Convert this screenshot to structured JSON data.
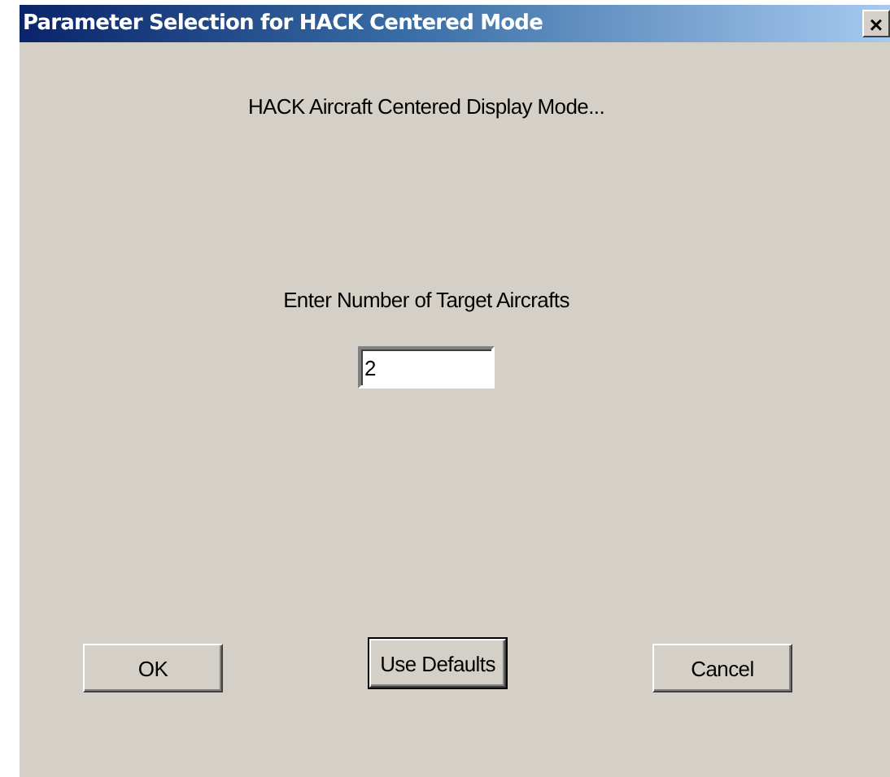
{
  "window": {
    "title": "Parameter Selection for HACK Centered Mode",
    "close": "×"
  },
  "heading": "HACK Aircraft Centered Display Mode...",
  "field": {
    "label": "Enter Number of Target Aircrafts",
    "value": "2"
  },
  "buttons": [
    {
      "label": "OK",
      "default": false
    },
    {
      "label": "Use Defaults",
      "default": true
    },
    {
      "label": "Cancel",
      "default": false
    }
  ]
}
